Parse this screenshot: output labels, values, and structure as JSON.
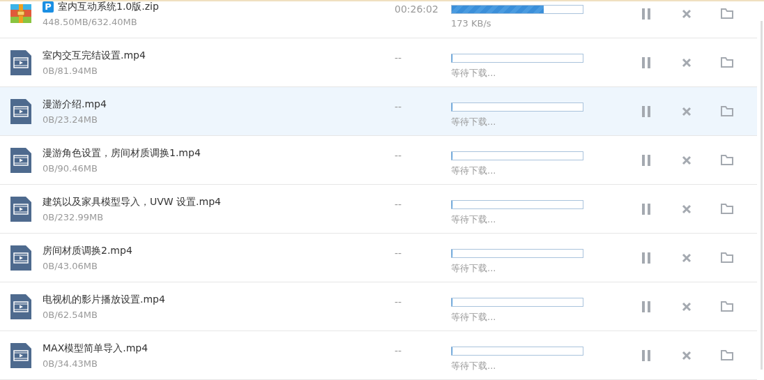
{
  "downloads": [
    {
      "kind": "archive",
      "badge": "P",
      "name": "室内互动系统1.0版.zip",
      "size": "448.50MB/632.40MB",
      "time": "00:26:02",
      "level": 0.7,
      "status": "173 KB/s",
      "selected": false
    },
    {
      "kind": "video",
      "name": "室内交互完结设置.mp4",
      "size": "0B/81.94MB",
      "time": "--",
      "level": 0,
      "status": "等待下载...",
      "selected": false
    },
    {
      "kind": "video",
      "name": "漫游介绍.mp4",
      "size": "0B/23.24MB",
      "time": "--",
      "level": 0,
      "status": "等待下载...",
      "selected": true
    },
    {
      "kind": "video",
      "name": "漫游角色设置，房间材质调换1.mp4",
      "size": "0B/90.46MB",
      "time": "--",
      "level": 0,
      "status": "等待下载...",
      "selected": false
    },
    {
      "kind": "video",
      "name": "建筑以及家具模型导入，UVW 设置.mp4",
      "size": "0B/232.99MB",
      "time": "--",
      "level": 0,
      "status": "等待下载...",
      "selected": false
    },
    {
      "kind": "video",
      "name": "房间材质调换2.mp4",
      "size": "0B/43.06MB",
      "time": "--",
      "level": 0,
      "status": "等待下载...",
      "selected": false
    },
    {
      "kind": "video",
      "name": "电视机的影片播放设置.mp4",
      "size": "0B/62.54MB",
      "time": "--",
      "level": 0,
      "status": "等待下载...",
      "selected": false
    },
    {
      "kind": "video",
      "name": "MAX模型简单导入.mp4",
      "size": "0B/34.43MB",
      "time": "--",
      "level": 0,
      "status": "等待下载...",
      "selected": false
    }
  ]
}
